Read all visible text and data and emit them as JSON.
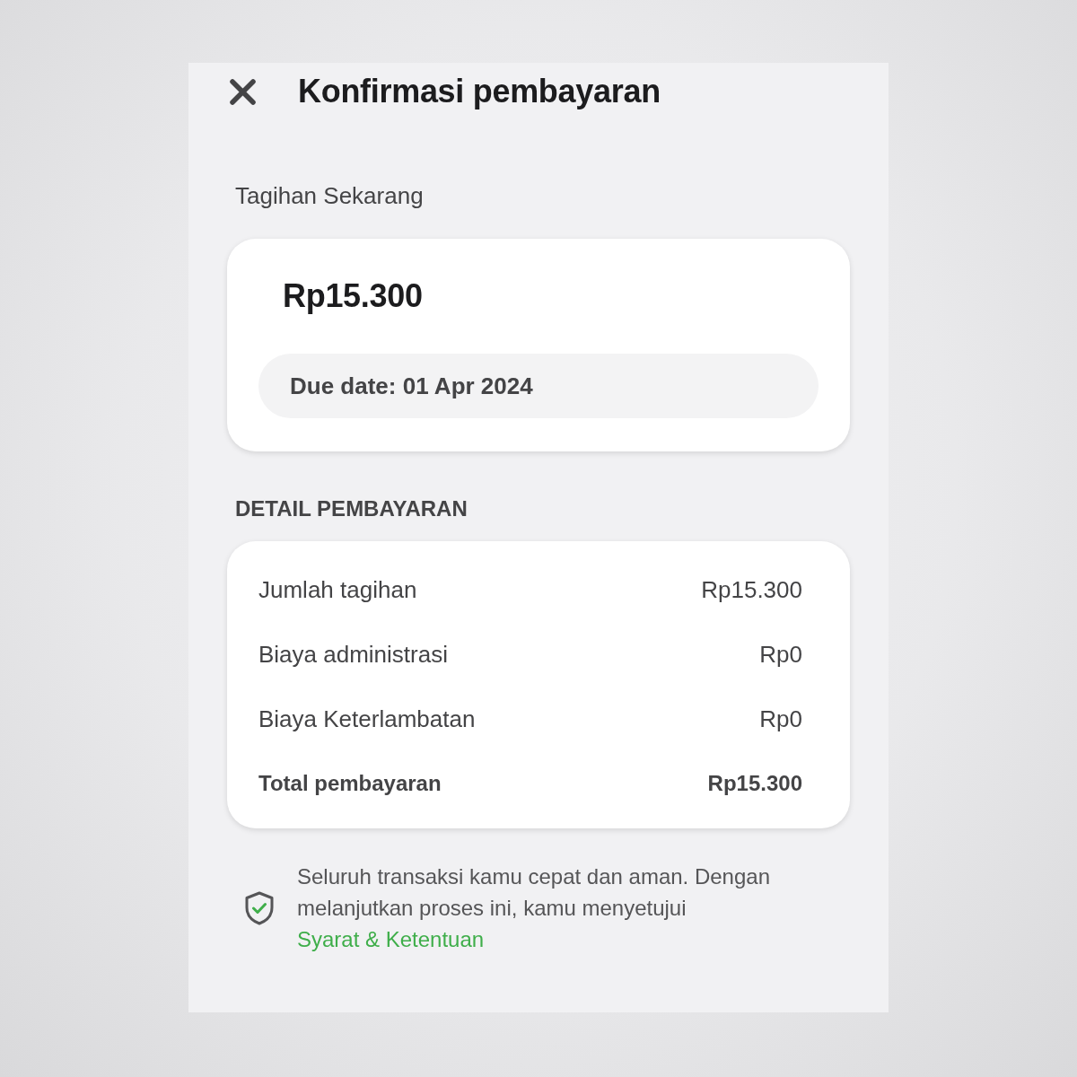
{
  "header": {
    "title": "Konfirmasi pembayaran"
  },
  "current_bill": {
    "label": "Tagihan Sekarang",
    "amount": "Rp15.300",
    "due_date": "Due date: 01 Apr 2024"
  },
  "payment_detail": {
    "heading": "DETAIL PEMBAYARAN",
    "rows": [
      {
        "kind": "item",
        "label": "Jumlah tagihan",
        "value": "Rp15.300"
      },
      {
        "kind": "item",
        "label": "Biaya administrasi",
        "value": "Rp0"
      },
      {
        "kind": "item",
        "label": "Biaya Keterlambatan",
        "value": "Rp0"
      },
      {
        "kind": "total",
        "label": "Total pembayaran",
        "value": "Rp15.300"
      }
    ]
  },
  "notice": {
    "text": "Seluruh transaksi kamu cepat dan aman. Dengan melanjutkan proses ini, kamu menyetujui",
    "link": "Syarat & Ketentuan"
  }
}
